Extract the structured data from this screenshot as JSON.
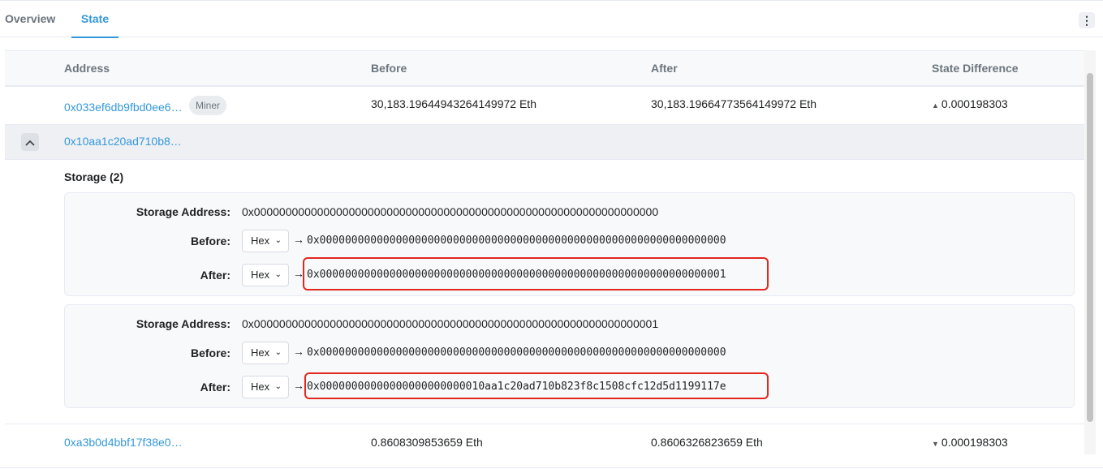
{
  "tabs": {
    "overview": "Overview",
    "state": "State",
    "more_icon": "more-vertical-icon"
  },
  "table": {
    "headers": {
      "address": "Address",
      "before": "Before",
      "after": "After",
      "diff": "State Difference"
    },
    "rows": [
      {
        "address": "0x033ef6db9fbd0ee6…",
        "badge": "Miner",
        "before": "30,183.19644943264149972 Eth",
        "after": "30,183.19664773564149972 Eth",
        "diff": "0.000198303",
        "diff_direction": "up"
      },
      {
        "address": "0x10aa1c20ad710b8…"
      },
      {
        "address": "0xa3b0d4bbf17f38e0…",
        "before": "0.8608309853659 Eth",
        "after": "0.8606326823659 Eth",
        "diff": "0.000198303",
        "diff_direction": "down"
      }
    ]
  },
  "storage": {
    "title": "Storage (2)",
    "labels": {
      "address": "Storage Address:",
      "before": "Before:",
      "after": "After:"
    },
    "format_option": "Hex",
    "entries": [
      {
        "address": "0x0000000000000000000000000000000000000000000000000000000000000000",
        "before": "0x0000000000000000000000000000000000000000000000000000000000000000",
        "after": "0x0000000000000000000000000000000000000000000000000000000000000001"
      },
      {
        "address": "0x0000000000000000000000000000000000000000000000000000000000000001",
        "before": "0x0000000000000000000000000000000000000000000000000000000000000000",
        "after": "0x00000000000000000000000010aa1c20ad710b823f8c1508cfc12d5d1199117e"
      }
    ]
  },
  "colors": {
    "link": "#3498db",
    "highlight": "#e0281e"
  }
}
